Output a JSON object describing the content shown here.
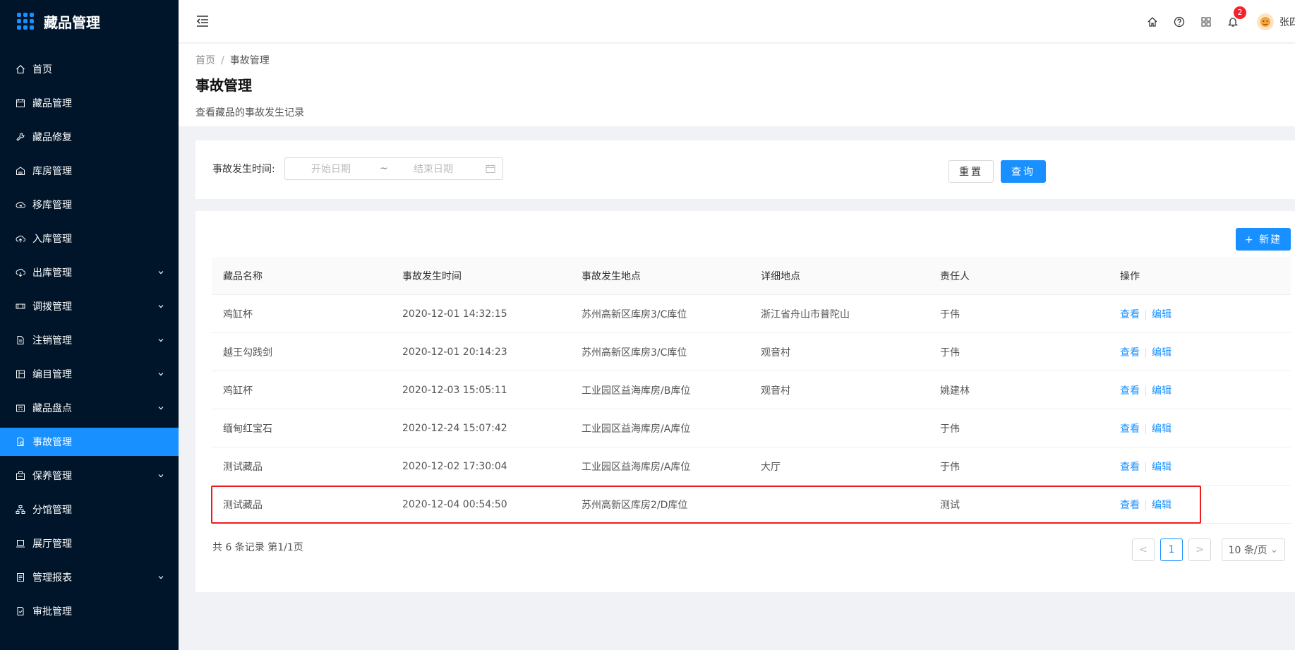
{
  "app": {
    "title": "藏品管理"
  },
  "sidebar": {
    "items": [
      {
        "label": "首页",
        "icon": "home-icon",
        "has_arrow": false
      },
      {
        "label": "藏品管理",
        "icon": "calendar-icon",
        "has_arrow": false
      },
      {
        "label": "藏品修复",
        "icon": "wrench-icon",
        "has_arrow": false
      },
      {
        "label": "库房管理",
        "icon": "warehouse-icon",
        "has_arrow": false
      },
      {
        "label": "移库管理",
        "icon": "cloud-sync-icon",
        "has_arrow": false
      },
      {
        "label": "入库管理",
        "icon": "cloud-upload-icon",
        "has_arrow": false
      },
      {
        "label": "出库管理",
        "icon": "cloud-download-icon",
        "has_arrow": true
      },
      {
        "label": "调拨管理",
        "icon": "transfer-icon",
        "has_arrow": true
      },
      {
        "label": "注销管理",
        "icon": "file-icon",
        "has_arrow": true
      },
      {
        "label": "编目管理",
        "icon": "catalog-icon",
        "has_arrow": true
      },
      {
        "label": "藏品盘点",
        "icon": "inventory-icon",
        "has_arrow": true
      },
      {
        "label": "事故管理",
        "icon": "accident-icon",
        "has_arrow": false,
        "active": true
      },
      {
        "label": "保养管理",
        "icon": "maintenance-icon",
        "has_arrow": true
      },
      {
        "label": "分馆管理",
        "icon": "branch-icon",
        "has_arrow": false
      },
      {
        "label": "展厅管理",
        "icon": "laptop-icon",
        "has_arrow": false
      },
      {
        "label": "管理报表",
        "icon": "report-icon",
        "has_arrow": true
      },
      {
        "label": "审批管理",
        "icon": "approval-icon",
        "has_arrow": false
      }
    ]
  },
  "header": {
    "notification_count": "2",
    "user_name": "张四"
  },
  "breadcrumb": {
    "home": "首页",
    "separator": "/",
    "current": "事故管理"
  },
  "page": {
    "title": "事故管理",
    "description": "查看藏品的事故发生记录"
  },
  "search": {
    "label": "事故发生时间:",
    "start_placeholder": "开始日期",
    "range_separator": "~",
    "end_placeholder": "结束日期",
    "reset_label": "重置",
    "query_label": "查询"
  },
  "table": {
    "new_label": "+ 新建",
    "columns": [
      "藏品名称",
      "事故发生时间",
      "事故发生地点",
      "详细地点",
      "责任人",
      "操作"
    ],
    "rows": [
      {
        "name": "鸡缸杯",
        "time": "2020-12-01 14:32:15",
        "place": "苏州高新区库房3/C库位",
        "detail": "浙江省舟山市普陀山",
        "person": "于伟"
      },
      {
        "name": "越王勾践剑",
        "time": "2020-12-01 20:14:23",
        "place": "苏州高新区库房3/C库位",
        "detail": "观音村",
        "person": "于伟"
      },
      {
        "name": "鸡缸杯",
        "time": "2020-12-03 15:05:11",
        "place": "工业园区益海库房/B库位",
        "detail": "观音村",
        "person": "姚建林"
      },
      {
        "name": "缅甸红宝石",
        "time": "2020-12-24 15:07:42",
        "place": "工业园区益海库房/A库位",
        "detail": "",
        "person": "于伟"
      },
      {
        "name": "测试藏品",
        "time": "2020-12-02 17:30:04",
        "place": "工业园区益海库房/A库位",
        "detail": "大厅",
        "person": "于伟"
      },
      {
        "name": "测试藏品",
        "time": "2020-12-04 00:54:50",
        "place": "苏州高新区库房2/D库位",
        "detail": "",
        "person": "测试"
      }
    ],
    "view_label": "查看",
    "edit_label": "编辑"
  },
  "pagination": {
    "summary": "共 6 条记录 第1/1页",
    "current_page": "1",
    "page_size": "10 条/页",
    "prev": "<",
    "next": ">"
  },
  "colors": {
    "sidebar_bg": "#001529",
    "accent": "#1890ff",
    "highlight_border": "#ee1c1c"
  }
}
